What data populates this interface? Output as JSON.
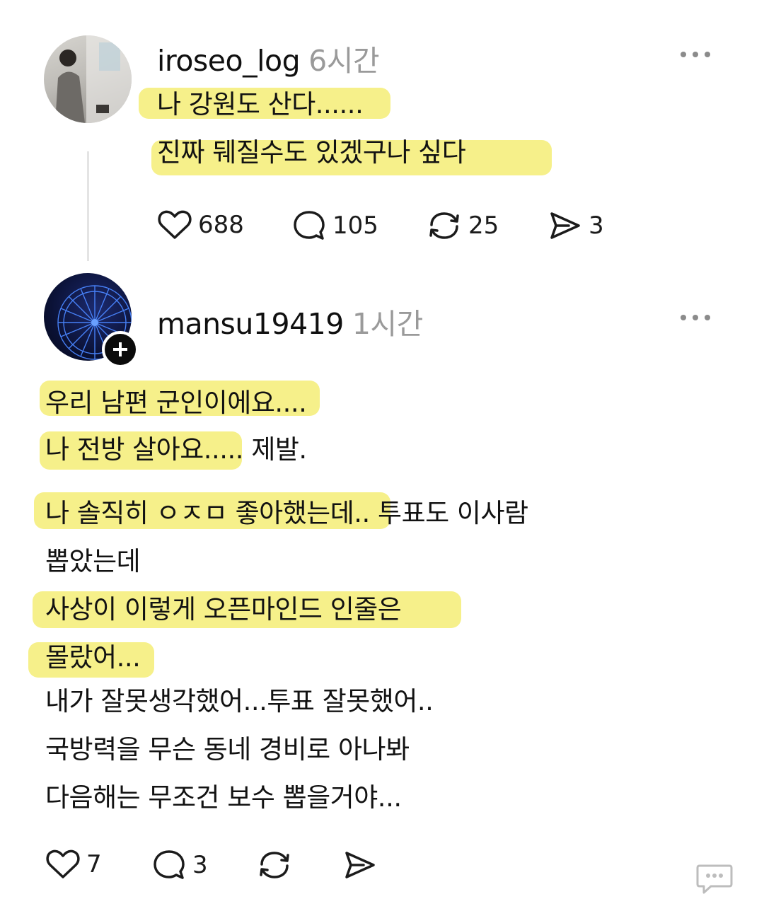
{
  "posts": [
    {
      "username": "iroseo_log",
      "time": "6시간",
      "lines": [
        "나 강원도 산다......",
        "진짜 뒈질수도 있겠구나 싶다"
      ],
      "actions": {
        "likes": "688",
        "comments": "105",
        "reposts": "25",
        "shares": "3"
      }
    },
    {
      "username": "mansu19419",
      "time": "1시간",
      "lines": [
        "우리 남편 군인이에요....",
        "나 전방 살아요..... 제발.",
        "나 솔직히 ㅇㅈㅁ 좋아했는데.. 투표도 이사람",
        "뽑았는데",
        "사상이 이렇게 오픈마인드 인줄은",
        "몰랐어...",
        "내가 잘못생각했어...투표 잘못했어..",
        "국방력을 무슨 동네 경비로 아나봐",
        "다음해는 무조건 보수 뽑을거야..."
      ],
      "actions": {
        "likes": "7",
        "comments": "3"
      }
    }
  ],
  "colors": {
    "highlight": "#f6f08a",
    "muted": "#9a9a9a",
    "text": "#141414"
  },
  "icons": [
    "heart-icon",
    "comment-icon",
    "repost-icon",
    "share-icon",
    "more-icon",
    "follow-plus-icon",
    "chat-bubble-icon"
  ]
}
